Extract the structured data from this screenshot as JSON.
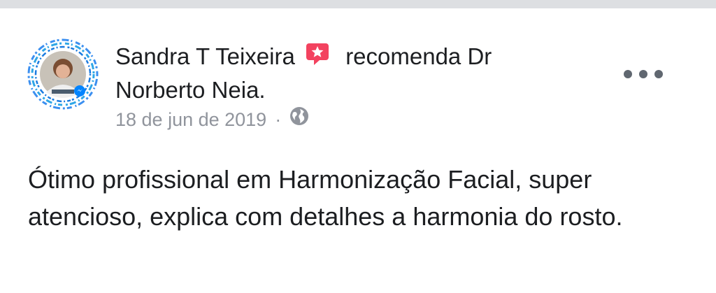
{
  "post": {
    "author": "Sandra T Teixeira",
    "recommendation_text": "recomenda Dr Norberto Neia.",
    "date": "18 de jun de 2019",
    "separator": "·",
    "privacy_icon": "globe-icon",
    "recommend_icon": "recommend-badge-icon",
    "more_icon": "more-options-icon",
    "body": "Ótimo profissional em Harmonização Facial, super atencioso, explica com detalhes a harmonia do rosto."
  },
  "colors": {
    "text_primary": "#1c1e21",
    "text_secondary": "#90949c",
    "recommend_badge": "#f3425f",
    "messenger_blue": "#0084ff",
    "divider": "#dddfe2"
  }
}
